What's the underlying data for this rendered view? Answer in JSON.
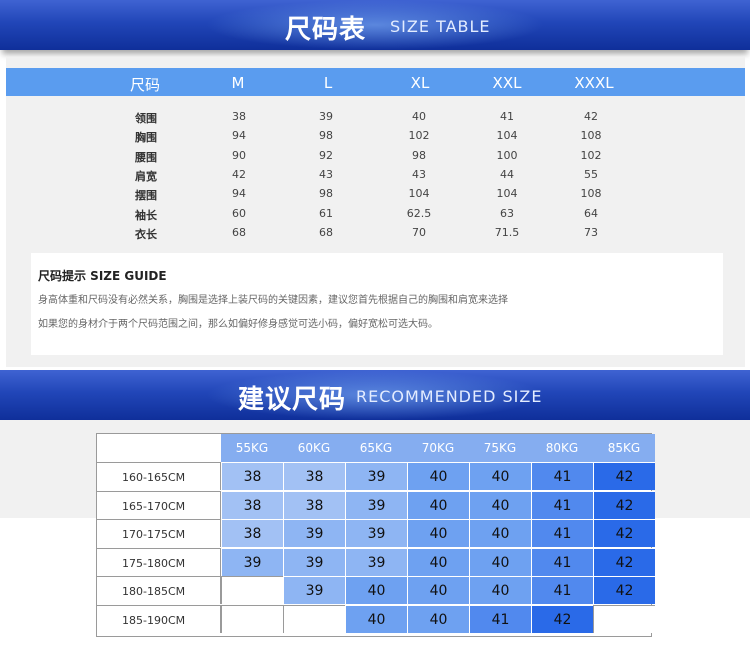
{
  "size_section": {
    "title_zh": "尺码表",
    "title_en": "SIZE TABLE"
  },
  "size_table": {
    "label_header": "尺码",
    "sizes": [
      "M",
      "L",
      "XL",
      "XXL",
      "XXXL"
    ],
    "rows": [
      {
        "label": "领围",
        "values": [
          "38",
          "39",
          "40",
          "41",
          "42"
        ]
      },
      {
        "label": "胸围",
        "values": [
          "94",
          "98",
          "102",
          "104",
          "108"
        ]
      },
      {
        "label": "腰围",
        "values": [
          "90",
          "92",
          "98",
          "100",
          "102"
        ]
      },
      {
        "label": "肩宽",
        "values": [
          "42",
          "43",
          "43",
          "44",
          "55"
        ]
      },
      {
        "label": "摆围",
        "values": [
          "94",
          "98",
          "104",
          "104",
          "108"
        ]
      },
      {
        "label": "袖长",
        "values": [
          "60",
          "61",
          "62.5",
          "63",
          "64"
        ]
      },
      {
        "label": "衣长",
        "values": [
          "68",
          "68",
          "70",
          "71.5",
          "73"
        ]
      }
    ]
  },
  "guide": {
    "title": "尺码提示 SIZE GUIDE",
    "line1": "身高体重和尺码没有必然关系，胸围是选择上装尺码的关键因素，建议您首先根据自己的胸围和肩宽来选择",
    "line2": "如果您的身材介于两个尺码范围之间，那么如偏好修身感觉可选小码，偏好宽松可选大码。"
  },
  "recommended_section": {
    "title_zh": "建议尺码",
    "title_en": "RECOMMENDED SIZE"
  },
  "recommended_table": {
    "weights": [
      "55KG",
      "60KG",
      "65KG",
      "70KG",
      "75KG",
      "80KG",
      "85KG"
    ],
    "rows": [
      {
        "height": "160-165CM",
        "values": [
          "38",
          "38",
          "39",
          "40",
          "40",
          "41",
          "42"
        ]
      },
      {
        "height": "165-170CM",
        "values": [
          "38",
          "38",
          "39",
          "40",
          "40",
          "41",
          "42"
        ]
      },
      {
        "height": "170-175CM",
        "values": [
          "38",
          "39",
          "39",
          "40",
          "40",
          "41",
          "42"
        ]
      },
      {
        "height": "175-180CM",
        "values": [
          "39",
          "39",
          "39",
          "40",
          "40",
          "41",
          "42"
        ]
      },
      {
        "height": "180-185CM",
        "values": [
          "",
          "39",
          "40",
          "40",
          "40",
          "41",
          "42"
        ]
      },
      {
        "height": "185-190CM",
        "values": [
          "",
          "",
          "40",
          "40",
          "41",
          "42",
          ""
        ]
      }
    ],
    "size_colors": {
      "38": "#a2c1f4",
      "39": "#8eb5f3",
      "40": "#6ea1f1",
      "41": "#5189ee",
      "42": "#2a6ae8"
    }
  }
}
